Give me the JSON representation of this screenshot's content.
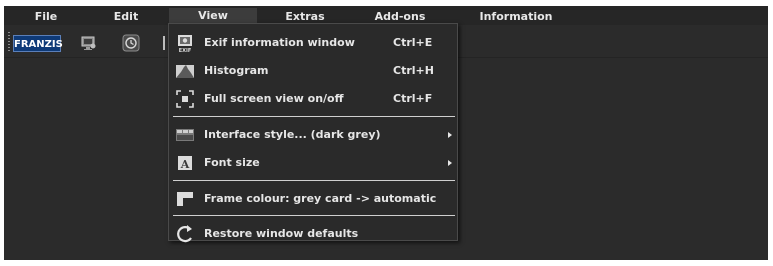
{
  "menubar": {
    "items": [
      "File",
      "Edit",
      "View",
      "Extras",
      "Add-ons",
      "Information"
    ],
    "active_index": 2
  },
  "toolbar": {
    "logo": "FRANZIS",
    "icons": [
      "monitor-icon",
      "history-icon",
      "divider-icon"
    ]
  },
  "dropdown": {
    "items": [
      {
        "label": "Exif information window",
        "shortcut": "Ctrl+E",
        "icon": "exif-icon"
      },
      {
        "label": "Histogram",
        "shortcut": "Ctrl+H",
        "icon": "histogram-icon"
      },
      {
        "label": "Full screen view on/off",
        "shortcut": "Ctrl+F",
        "icon": "fullscreen-icon"
      },
      {
        "label": "Interface style... (dark grey)",
        "shortcut": "",
        "icon": "interface-style-icon",
        "submenu": true
      },
      {
        "label": "Font size",
        "shortcut": "",
        "icon": "font-size-icon",
        "submenu": true
      },
      {
        "label": "Frame colour: grey card -> automatic",
        "shortcut": "",
        "icon": "frame-colour-icon"
      },
      {
        "label": "Restore window defaults",
        "shortcut": "",
        "icon": "restore-icon"
      }
    ]
  },
  "colors": {
    "background": "#2b2b2b",
    "menubar": "#262626",
    "menu_active": "#3c3c3c",
    "logo_bg": "#0e3a78"
  }
}
